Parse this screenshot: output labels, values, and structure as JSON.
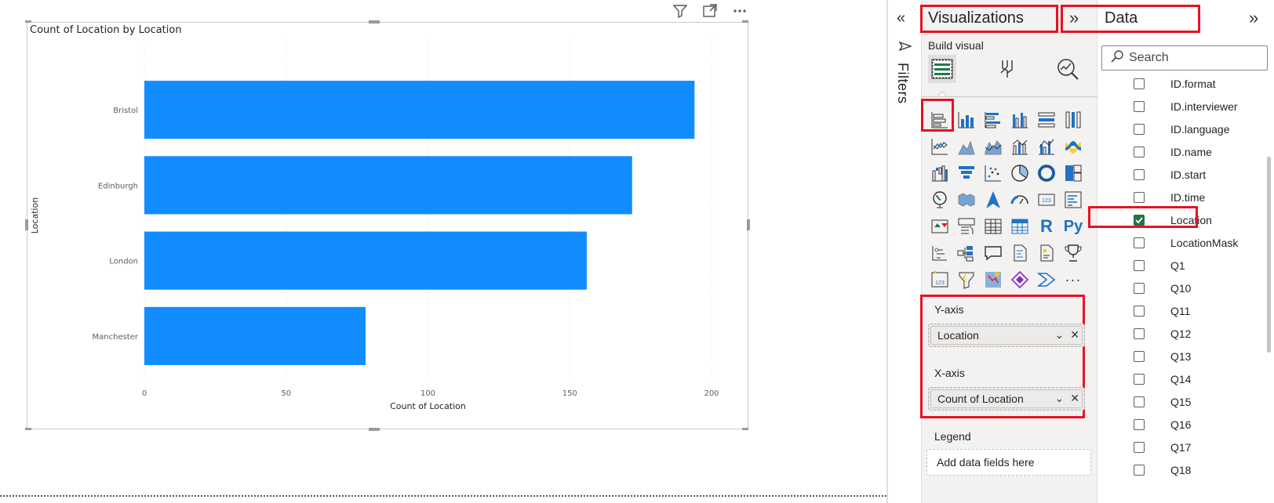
{
  "visual": {
    "header_icons": [
      "filter-icon",
      "focus-mode-icon",
      "more-options-icon"
    ]
  },
  "chart_data": {
    "type": "bar",
    "orientation": "horizontal",
    "title": "Count of Location by Location",
    "xlabel": "Count of Location",
    "ylabel": "Location",
    "categories": [
      "Bristol",
      "Edinburgh",
      "London",
      "Manchester"
    ],
    "values": [
      194,
      172,
      156,
      78
    ],
    "xlim": [
      0,
      200
    ],
    "xticks": [
      0,
      50,
      100,
      150,
      200
    ],
    "grid": "vertical-dotted",
    "bar_color": "#118dff"
  },
  "filters": {
    "label": "Filters"
  },
  "visualizations": {
    "title": "Visualizations",
    "build_visual": "Build visual",
    "tabs": [
      "build-visual-icon",
      "format-visual-icon",
      "analytics-icon"
    ],
    "viz_types": [
      "stacked-bar-chart-icon",
      "stacked-column-chart-icon",
      "clustered-bar-chart-icon",
      "clustered-column-chart-icon",
      "100-stacked-bar-chart-icon",
      "100-stacked-column-chart-icon",
      "line-chart-icon",
      "area-chart-icon",
      "stacked-area-chart-icon",
      "line-and-stacked-column-icon",
      "line-and-clustered-column-icon",
      "ribbon-chart-icon",
      "waterfall-chart-icon",
      "funnel-icon",
      "scatter-chart-icon",
      "pie-chart-icon",
      "donut-chart-icon",
      "treemap-icon",
      "map-icon",
      "filled-map-icon",
      "azure-map-icon",
      "gauge-icon",
      "card-icon",
      "multi-row-card-icon",
      "kpi-icon",
      "slicer-icon",
      "table-icon",
      "matrix-icon",
      "r-visual-icon",
      "python-visual-icon",
      "key-influencers-icon",
      "decomposition-tree-icon",
      "qa-icon",
      "smart-narrative-icon",
      "paginated-report-icon",
      "scorecard-icon",
      "power-automate-icon",
      "power-apps-icon",
      "arcgis-icon",
      "metrics-icon",
      "power-automate-flow-icon",
      "more-visuals-icon"
    ],
    "r_label": "R",
    "py_label": "Py",
    "more_label": "···",
    "wells": {
      "y_axis_label": "Y-axis",
      "y_axis_field": "Location",
      "x_axis_label": "X-axis",
      "x_axis_field": "Count of Location",
      "legend_label": "Legend",
      "legend_placeholder": "Add data fields here"
    }
  },
  "data_pane": {
    "title": "Data",
    "search_placeholder": "Search",
    "fields": [
      {
        "name": "ID.format",
        "checked": false
      },
      {
        "name": "ID.interviewer",
        "checked": false
      },
      {
        "name": "ID.language",
        "checked": false
      },
      {
        "name": "ID.name",
        "checked": false
      },
      {
        "name": "ID.start",
        "checked": false
      },
      {
        "name": "ID.time",
        "checked": false
      },
      {
        "name": "Location",
        "checked": true
      },
      {
        "name": "LocationMask",
        "checked": false
      },
      {
        "name": "Q1",
        "checked": false
      },
      {
        "name": "Q10",
        "checked": false
      },
      {
        "name": "Q11",
        "checked": false
      },
      {
        "name": "Q12",
        "checked": false
      },
      {
        "name": "Q13",
        "checked": false
      },
      {
        "name": "Q14",
        "checked": false
      },
      {
        "name": "Q15",
        "checked": false
      },
      {
        "name": "Q16",
        "checked": false
      },
      {
        "name": "Q17",
        "checked": false
      },
      {
        "name": "Q18",
        "checked": false
      }
    ]
  },
  "colors": {
    "accent": "#118dff",
    "highlight_box": "#e81123",
    "checked": "#217346"
  }
}
